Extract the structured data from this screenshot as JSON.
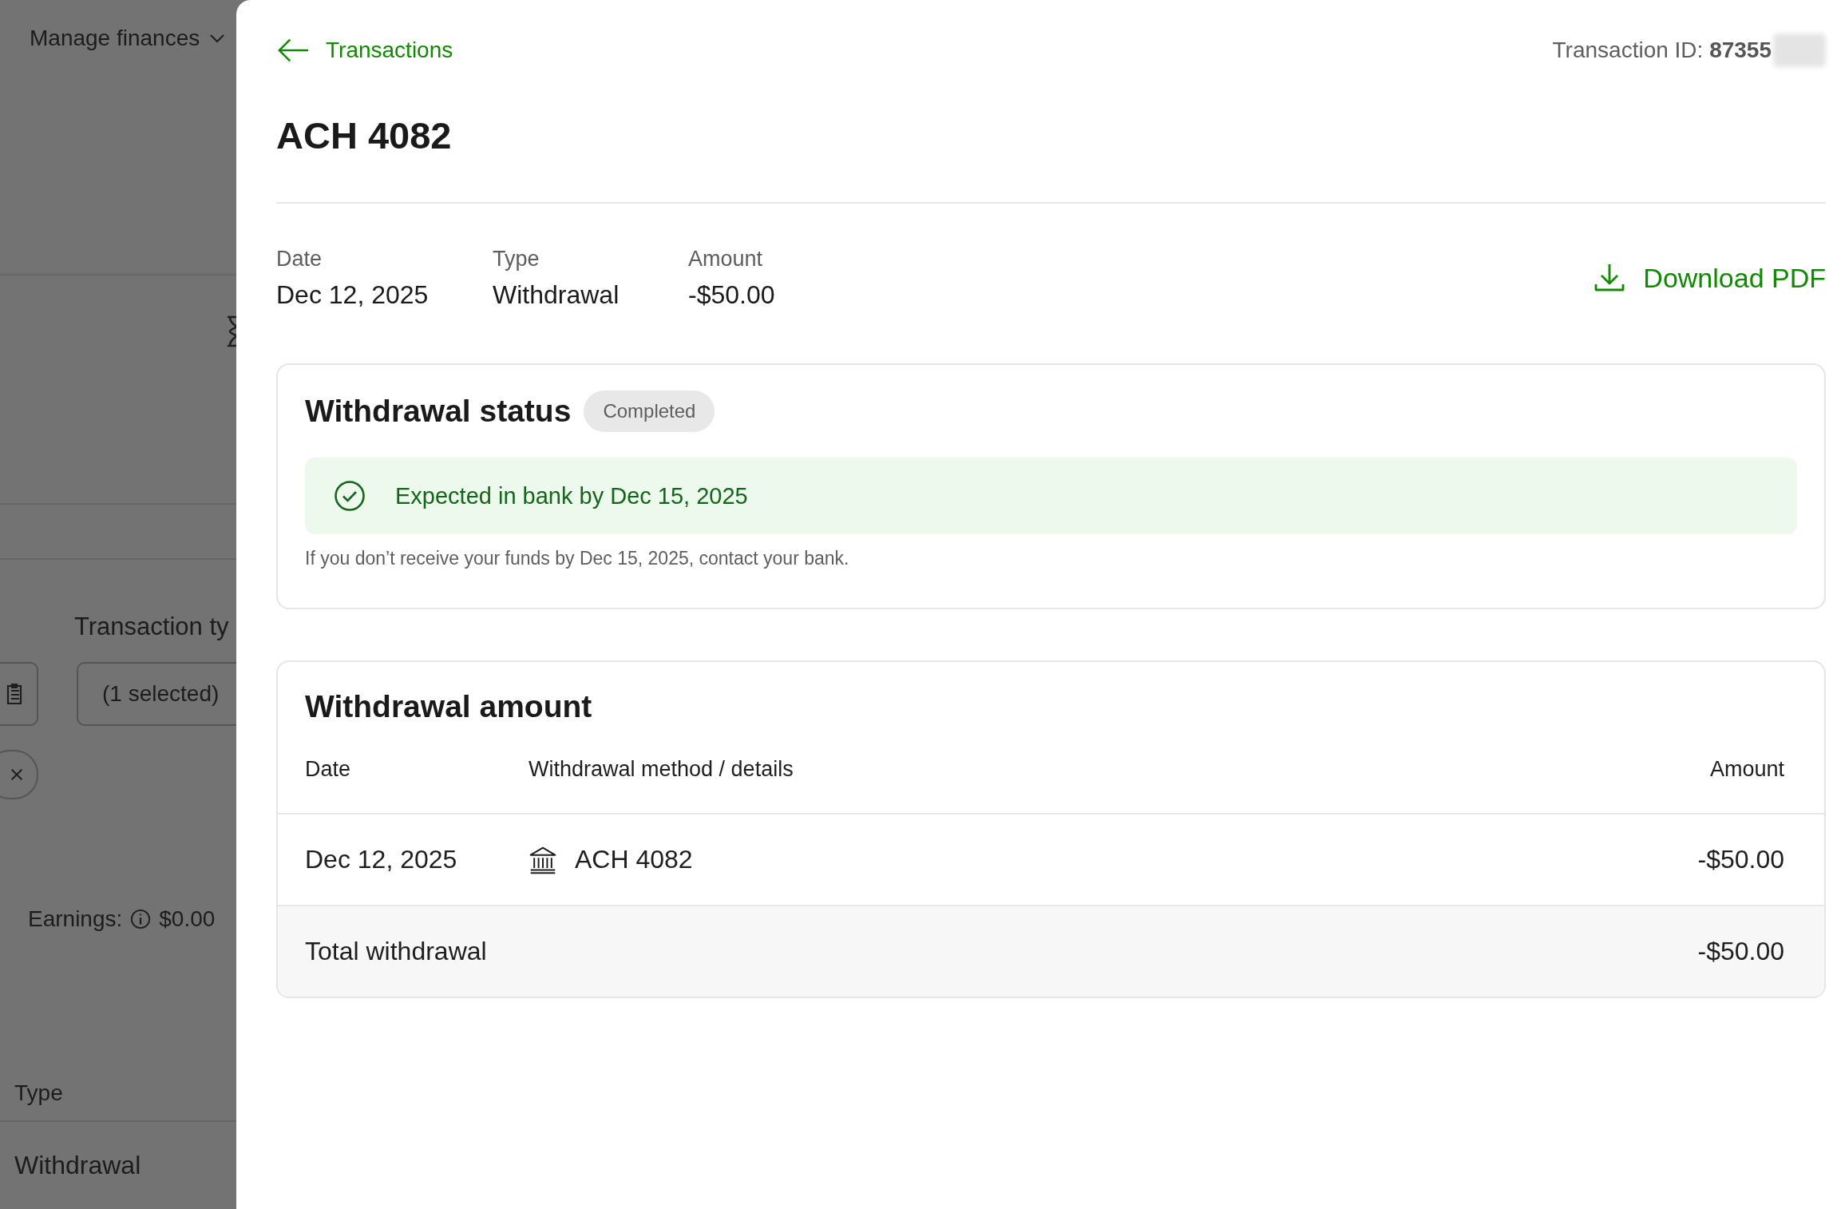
{
  "background": {
    "menu": {
      "label": "Manage finances"
    },
    "filter_label": "Transaction ty",
    "filter_button": "(1 selected)",
    "earnings": {
      "label": "Earnings:",
      "value": "$0.00"
    },
    "table": {
      "column": "Type",
      "rows": [
        "Withdrawal"
      ]
    }
  },
  "back_link": "Transactions",
  "transaction_id": "Transaction ID: **87355**",
  "title": "ACH 4082",
  "summary": [
    {
      "label": "Date",
      "value": "Dec 12, 2025"
    },
    {
      "label": "Type",
      "value": "Withdrawal"
    },
    {
      "label": "Amount",
      "value": "-$50.00"
    }
  ],
  "download": "Download PDF",
  "status_card": {
    "title": "Withdrawal status",
    "badge": "Completed",
    "banner": "Expected in bank by Dec 15, 2025",
    "note": "If you don’t receive your funds by Dec 15, 2025, contact your bank."
  },
  "amount_card": {
    "title": "Withdrawal amount",
    "columns": [
      "Date",
      "Withdrawal method / details",
      "Amount"
    ],
    "rows": [
      {
        "date": "Dec 12, 2025",
        "method": "ACH 4082",
        "amount": "-$50.00"
      }
    ],
    "total": {
      "label": "Total withdrawal",
      "amount": "-$50.00"
    }
  }
}
